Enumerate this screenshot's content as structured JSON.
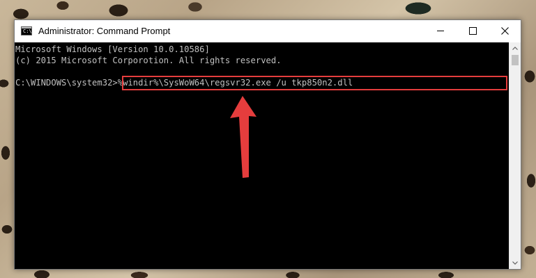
{
  "window": {
    "title": "Administrator: Command Prompt",
    "icon_label": "C:\\"
  },
  "controls": {
    "minimize": "minimize-icon",
    "maximize": "maximize-icon",
    "close": "close-icon"
  },
  "console": {
    "line1": "Microsoft Windows [Version 10.0.10586]",
    "line2": "(c) 2015 Microsoft Corporotion. All rights reserved.",
    "prompt": "C:\\WINDOWS\\system32>",
    "command": "%windir%\\SysWoW64\\regsvr32.exe /u tkp850n2.dll"
  },
  "annotation": {
    "highlight_color": "#e53d3d",
    "arrow_color": "#e53d3d"
  },
  "colors": {
    "console_bg": "#000000",
    "console_text": "#c0c0c0"
  }
}
